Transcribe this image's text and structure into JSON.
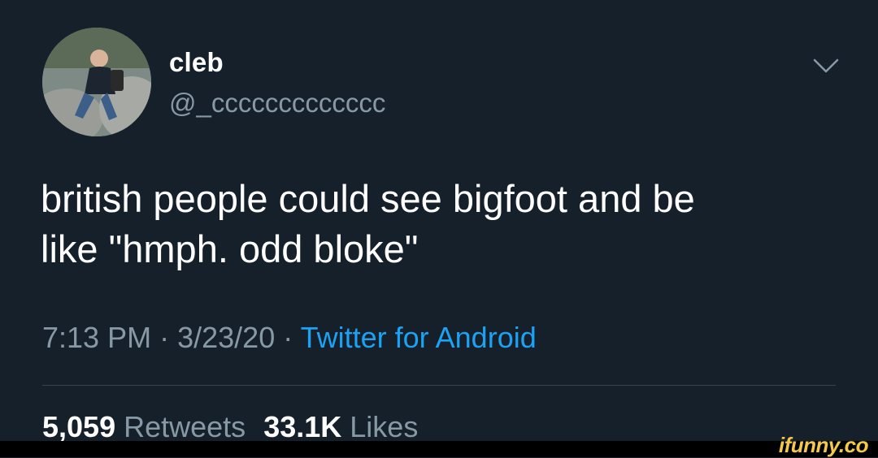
{
  "tweet": {
    "display_name": "cleb",
    "handle": "@_ccccccccccccc",
    "text_line1": "british people could see bigfoot and be",
    "text_line2": "like \"hmph. odd bloke\"",
    "time": "7:13 PM",
    "separator": "·",
    "date": "3/23/20",
    "source": "Twitter for Android",
    "retweets_count": "5,059",
    "retweets_label": "Retweets",
    "likes_count": "33.1K",
    "likes_label": "Likes"
  },
  "watermark": "ifunny.co",
  "icons": {
    "menu": "chevron-down-icon"
  },
  "colors": {
    "background": "#15202b",
    "primary_text": "#ffffff",
    "secondary_text": "#8899a6",
    "link": "#1da1f2",
    "divider": "#38444d",
    "watermark": "#f2c94c"
  }
}
